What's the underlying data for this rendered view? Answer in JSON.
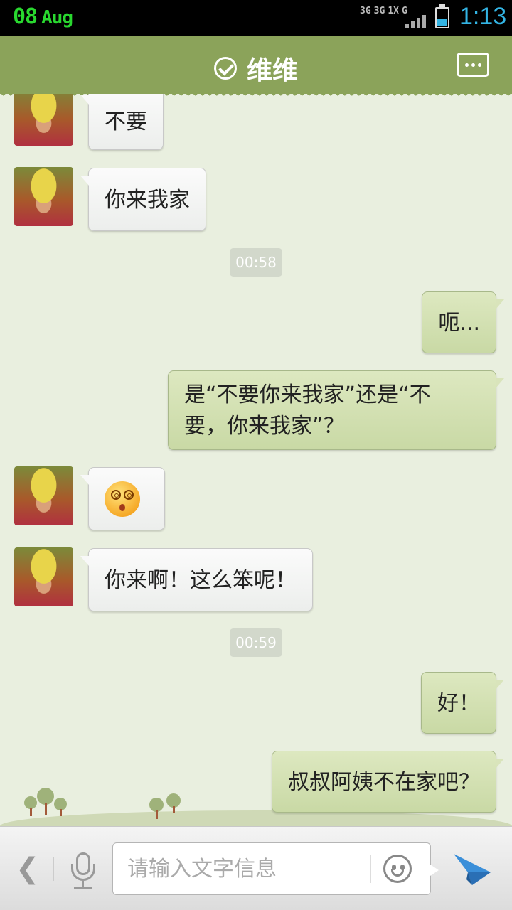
{
  "status_bar": {
    "day": "08",
    "month": "Aug",
    "network_top": [
      "3G",
      "3G",
      "1X",
      "G"
    ],
    "time": "1:13"
  },
  "header": {
    "title": "维维",
    "more_icon": "more-dots-icon",
    "verified_icon": "check-circle-icon"
  },
  "messages": [
    {
      "type": "incoming",
      "text": "不要"
    },
    {
      "type": "incoming",
      "text": "你来我家"
    },
    {
      "type": "time",
      "text": "00:58"
    },
    {
      "type": "outgoing",
      "text": "呃..."
    },
    {
      "type": "outgoing",
      "text_line1": "是“不要你来我家”还是“不",
      "text_line2": "要，你来我家”？"
    },
    {
      "type": "incoming",
      "emoji": "dizzy-face-icon"
    },
    {
      "type": "incoming",
      "text": "你来啊！这么笨呢！"
    },
    {
      "type": "time",
      "text": "00:59"
    },
    {
      "type": "outgoing",
      "text": "好！"
    },
    {
      "type": "outgoing",
      "text": "叔叔阿姨不在家吧？"
    }
  ],
  "input_bar": {
    "collapse_label": "❮",
    "placeholder": "请输入文字信息",
    "voice_icon": "microphone-icon",
    "emoji_icon": "smiley-icon",
    "send_icon": "send-icon"
  },
  "colors": {
    "header": "#8ba35a",
    "background": "#e9efdf",
    "outgoing_bubble": "#cfdcaa",
    "incoming_bubble": "#f5f5f5",
    "clock": "#33b5e5",
    "date": "#29d82f"
  }
}
